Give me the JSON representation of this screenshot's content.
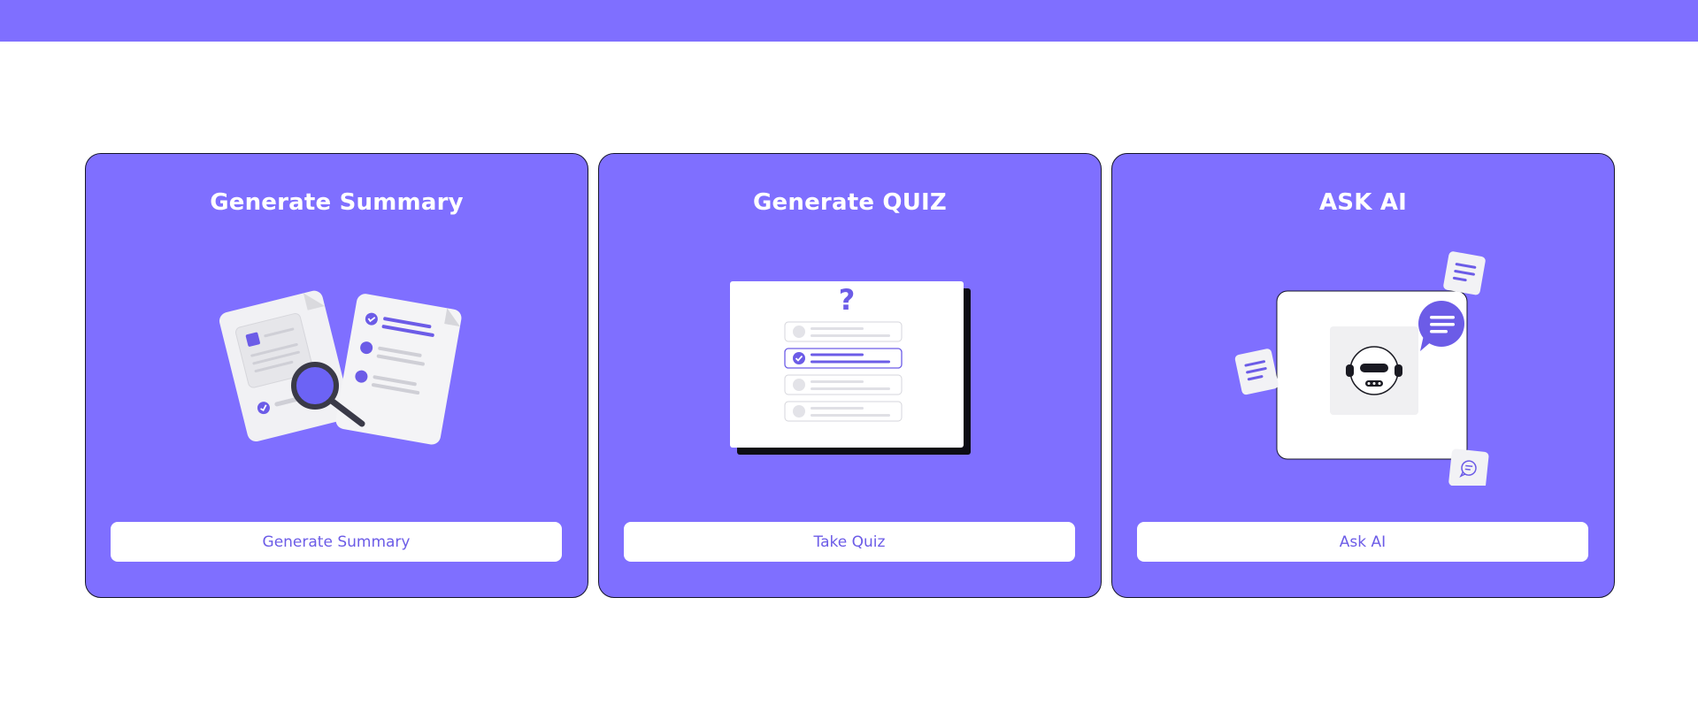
{
  "cards": [
    {
      "title": "Generate Summary",
      "button_label": "Generate Summary",
      "illustration": "documents-magnifier-icon"
    },
    {
      "title": "Generate QUIZ",
      "button_label": "Take Quiz",
      "illustration": "quiz-checklist-icon"
    },
    {
      "title": "ASK AI",
      "button_label": "Ask AI",
      "illustration": "ai-robot-chat-icon"
    }
  ],
  "colors": {
    "primary": "#7f6fff",
    "accent": "#6c5ce7",
    "background": "#ffffff"
  },
  "quiz_illustration": {
    "symbol": "?"
  }
}
